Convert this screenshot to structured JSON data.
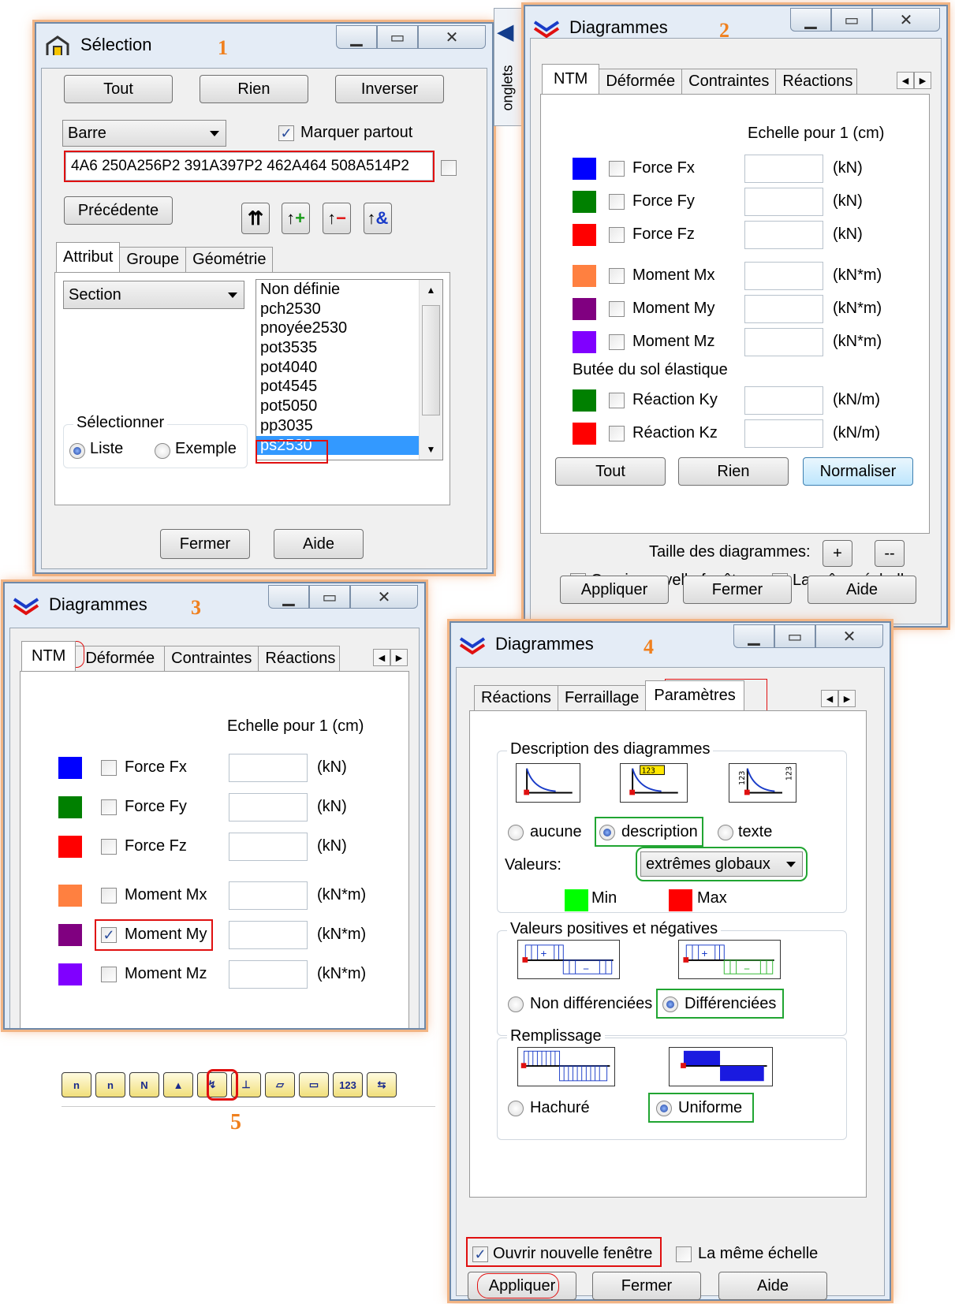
{
  "selection": {
    "title": "Sélection",
    "number": "1",
    "buttons": {
      "all": "Tout",
      "none": "Rien",
      "invert": "Inverser",
      "previous": "Précédente",
      "close": "Fermer",
      "help": "Aide"
    },
    "type_dropdown": "Barre",
    "mark_everywhere": "Marquer partout",
    "selection_string": "4A6 250A256P2 391A397P2 462A464 508A514P2",
    "tabs": [
      "Attribut",
      "Groupe",
      "Géométrie"
    ],
    "attribute_dropdown": "Section",
    "select_group": "Sélectionner",
    "radio": {
      "list": "Liste",
      "example": "Exemple"
    },
    "sections": [
      "Non définie",
      "pch2530",
      "pnoyée2530",
      "pot3535",
      "pot4040",
      "pot4545",
      "pot5050",
      "pp3035",
      "ps2530"
    ],
    "selected_section": "ps2530"
  },
  "onglets_label": "onglets",
  "diag2": {
    "title": "Diagrammes",
    "number": "2",
    "tabs": [
      "NTM",
      "Déformée",
      "Contraintes",
      "Réactions"
    ],
    "scale_header": "Echelle pour 1  (cm)",
    "rows": [
      {
        "label": "Force Fx",
        "unit": "(kN)",
        "color": "#0000ff"
      },
      {
        "label": "Force Fy",
        "unit": "(kN)",
        "color": "#008000"
      },
      {
        "label": "Force Fz",
        "unit": "(kN)",
        "color": "#ff0000"
      },
      {
        "label": "Moment Mx",
        "unit": "(kN*m)",
        "color": "#ff8040"
      },
      {
        "label": "Moment My",
        "unit": "(kN*m)",
        "color": "#800080"
      },
      {
        "label": "Moment Mz",
        "unit": "(kN*m)",
        "color": "#8000ff"
      }
    ],
    "soil_header": "Butée du sol élastique",
    "soil_rows": [
      {
        "label": "Réaction Ky",
        "unit": "(kN/m)",
        "color": "#008000"
      },
      {
        "label": "Réaction Kz",
        "unit": "(kN/m)",
        "color": "#ff0000"
      }
    ],
    "btn_all": "Tout",
    "btn_none": "Rien",
    "btn_normalize": "Normaliser",
    "size_label": "Taille des diagrammes:",
    "plus": "+",
    "minus": "--",
    "open_new": "Ouvrir nouvelle fenêtre",
    "same_scale": "La même échelle",
    "apply": "Appliquer",
    "close": "Fermer",
    "help": "Aide"
  },
  "diag3": {
    "title": "Diagrammes",
    "number": "3",
    "tabs": [
      "NTM",
      "Déformée",
      "Contraintes",
      "Réactions"
    ],
    "scale_header": "Echelle pour 1  (cm)",
    "rows": [
      {
        "label": "Force Fx",
        "unit": "(kN)",
        "color": "#0000ff",
        "checked": false
      },
      {
        "label": "Force Fy",
        "unit": "(kN)",
        "color": "#008000",
        "checked": false
      },
      {
        "label": "Force Fz",
        "unit": "(kN)",
        "color": "#ff0000",
        "checked": false
      },
      {
        "label": "Moment Mx",
        "unit": "(kN*m)",
        "color": "#ff8040",
        "checked": false
      },
      {
        "label": "Moment My",
        "unit": "(kN*m)",
        "color": "#800080",
        "checked": true
      },
      {
        "label": "Moment Mz",
        "unit": "(kN*m)",
        "color": "#8000ff",
        "checked": false
      }
    ]
  },
  "diag4": {
    "title": "Diagrammes",
    "number": "4",
    "tabs": [
      "Réactions",
      "Ferraillage",
      "Paramètres"
    ],
    "desc_group": "Description des diagrammes",
    "desc_options": [
      "aucune",
      "description",
      "texte"
    ],
    "values_label": "Valeurs:",
    "values_dropdown": "extrêmes globaux",
    "min_label": "Min",
    "max_label": "Max",
    "min_color": "#00ff00",
    "max_color": "#ff0000",
    "pos_neg_group": "Valeurs positives et négatives",
    "pos_neg_options": [
      "Non différenciées",
      "Différenciées"
    ],
    "fill_group": "Remplissage",
    "fill_options": [
      "Hachuré",
      "Uniforme"
    ],
    "open_new": "Ouvrir nouvelle fenêtre",
    "same_scale": "La même échelle",
    "apply": "Appliquer",
    "close": "Fermer",
    "help": "Aide"
  },
  "toolbar": {
    "number": "5",
    "icons": [
      "diagram-n-icon",
      "diagram-n-sign-icon",
      "diagram-n12-icon",
      "diagram-beam-icon",
      "diagram-moment-icon",
      "diagram-support-icon",
      "diagram-plate-icon",
      "diagram-values-icon",
      "diagram-123-icon",
      "diagram-export-icon"
    ]
  }
}
